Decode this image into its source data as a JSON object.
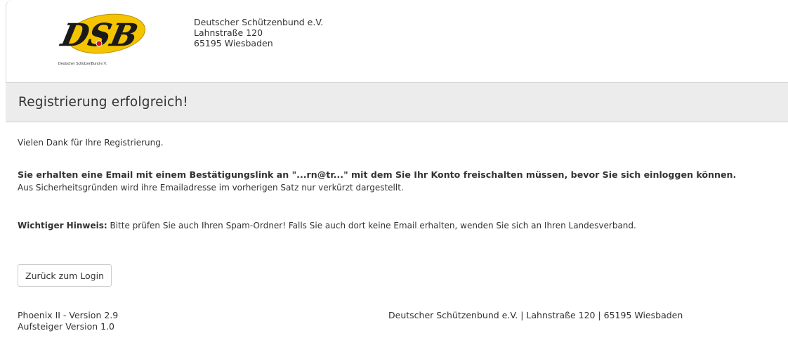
{
  "header": {
    "logo_letters": "DSB",
    "logo_caption": "Deutscher SchützenBund e.V.",
    "org_name": "Deutscher Schützenbund e.V.",
    "street": "Lahnstraße 120",
    "city": "65195 Wiesbaden"
  },
  "page": {
    "title": "Registrierung erfolgreich!"
  },
  "content": {
    "thanks": "Vielen Dank für Ihre Registrierung.",
    "email_notice": "Sie erhalten eine Email mit einem Bestätigungslink an \"...rn@tr...\" mit dem Sie Ihr Konto freischalten müssen, bevor Sie sich einloggen können.",
    "security_note": "Aus Sicherheitsgründen wird ihre Emailadresse im vorherigen Satz nur verkürzt dargestellt.",
    "hint_label": "Wichtiger Hinweis:",
    "hint_text": " Bitte prüfen Sie auch Ihren Spam-Ordner! Falls Sie auch dort keine Email erhalten, wenden Sie sich an Ihren Landesverband."
  },
  "actions": {
    "back_label": "Zurück zum Login"
  },
  "footer": {
    "version": "Phoenix II - Version 2.9",
    "sub_version": "Aufsteiger Version 1.0",
    "address": "Deutscher Schützenbund e.V. | Lahnstraße 120 | 65195 Wiesbaden"
  },
  "colors": {
    "logo_yellow": "#f5c400",
    "logo_red": "#d8141e",
    "title_bar": "#ececec"
  }
}
